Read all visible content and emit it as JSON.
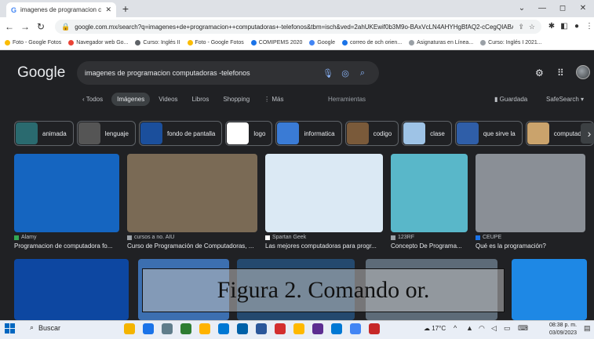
{
  "browser": {
    "tab_title": "imagenes de programacion com",
    "tab_close": "✕",
    "new_tab": "+",
    "url": "google.com.mx/search?q=imagenes+de+programacion++computadoras+-telefonos&tbm=isch&ved=2ahUKEwif0b3M9o-BAxVcLN4AHYHgBfAQ2-cCegQIABAA&...",
    "window_controls": [
      "⌄",
      "—",
      "◻",
      "✕"
    ],
    "bookmarks": [
      {
        "label": "Foto - Google Fotos",
        "color": "#fbbc04"
      },
      {
        "label": "Navegador web Go...",
        "color": "#ea4335"
      },
      {
        "label": "Curso: Inglés II",
        "color": "#5f6368"
      },
      {
        "label": "Foto - Google Fotos",
        "color": "#fbbc04"
      },
      {
        "label": "COMIPEMS 2020",
        "color": "#1a73e8"
      },
      {
        "label": "Google",
        "color": "#4285f4"
      },
      {
        "label": "correo de och orien...",
        "color": "#1a73e8"
      },
      {
        "label": "Asignaturas en Línea...",
        "color": "#9aa0a6"
      },
      {
        "label": "Curso: Inglés I 2021...",
        "color": "#9aa0a6"
      }
    ]
  },
  "google": {
    "logo": "Google",
    "query": "imagenes de programacion  computadoras -telefonos",
    "tabs": [
      "‹  Todos",
      "Imágenes",
      "Videos",
      "Libros",
      "Shopping",
      "⋮ Más"
    ],
    "active_tab": 1,
    "tools": "Herramientas",
    "saved": "Guardada",
    "safesearch": "SafeSearch ▾",
    "chips": [
      {
        "label": "animada",
        "color": "#2a6a6f"
      },
      {
        "label": "lenguaje",
        "color": "#555"
      },
      {
        "label": "fondo de pantalla",
        "color": "#1b4f9c"
      },
      {
        "label": "logo",
        "color": "#ffffff"
      },
      {
        "label": "informatica",
        "color": "#3a7bd5"
      },
      {
        "label": "codigo",
        "color": "#7a5a3a"
      },
      {
        "label": "clase",
        "color": "#9ec3e6"
      },
      {
        "label": "que sirve la",
        "color": "#2f5ea8"
      },
      {
        "label": "computador",
        "color": "#caa36c"
      }
    ],
    "results": [
      {
        "source": "Alamy",
        "title": "Programacion de computadora fo...",
        "color": "#1565c0",
        "src_color": "#34a853"
      },
      {
        "source": "cursos a no. AIU",
        "title": "Curso de Programación de Computadoras, ...",
        "color": "#7a6a55",
        "src_color": "#9aa0a6"
      },
      {
        "source": "Spartan Geek",
        "title": "Las mejores computadoras para progr...",
        "color": "#dbe9f4",
        "src_color": "#ffffff"
      },
      {
        "source": "123RF",
        "title": "Concepto De Programa...",
        "color": "#59b7c9",
        "src_color": "#9aa0a6"
      },
      {
        "source": "CEUPE",
        "title": "Qué es la programación?",
        "color": "#8a8f96",
        "src_color": "#1a73e8"
      }
    ],
    "row2_colors": [
      "#0d47a1",
      "#3c6fb0",
      "#24496e",
      "#5d6b78",
      "#1e88e5"
    ]
  },
  "overlay_caption": "Figura 2. Comando or.",
  "taskbar": {
    "search": "Buscar",
    "weather": "17°C",
    "time": "08:38 p. m.",
    "date": "03/09/2023",
    "app_colors": [
      "#f4b400",
      "#1a73e8",
      "#607d8b",
      "#2e7d32",
      "#ffb300",
      "#0078d4",
      "#0061a8",
      "#2b579a",
      "#d32f2f",
      "#ffb900",
      "#5c2d91",
      "#0078d4",
      "#4285f4",
      "#c62828"
    ]
  }
}
